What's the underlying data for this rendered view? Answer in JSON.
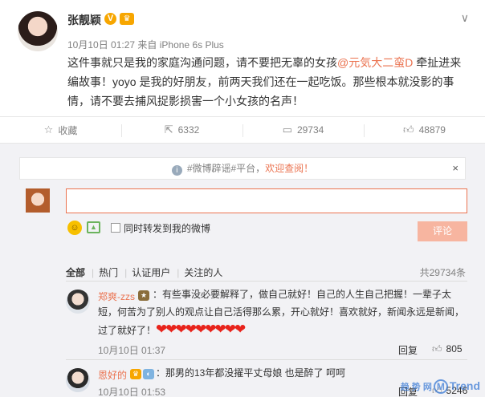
{
  "post": {
    "author": "张靓颖",
    "verified_mark": "V",
    "vip_mark": "♛",
    "time": "10月10日 01:27",
    "source": "来自 iPhone 6s Plus",
    "text_before": "这件事就只是我的家庭沟通问题，请不要把无辜的女孩",
    "mention": "@元気大二蛮D",
    "text_after": " 牵扯进来编故事！yoyo 是我的好朋友，前两天我们还在一起吃饭。那些根本就没影的事情，请不要去捕风捉影损害一个小女孩的名声！",
    "menu_icon": "chevron-down-icon"
  },
  "actions": {
    "favorite": {
      "icon": "star-icon",
      "label": "收藏"
    },
    "repost": {
      "icon": "repost-icon",
      "label": "6332"
    },
    "comment": {
      "icon": "comment-icon",
      "label": "29734"
    },
    "like": {
      "icon": "thumb-up-icon",
      "label": "48879"
    }
  },
  "notice": {
    "text": "#微博辟谣#平台，",
    "link": "欢迎查阅！",
    "close": "×"
  },
  "compose": {
    "value": "",
    "repost_label": "同时转发到我的微博",
    "submit": "评论"
  },
  "filters": {
    "items": [
      "全部",
      "热门",
      "认证用户",
      "关注的人"
    ],
    "total": "共29734条"
  },
  "comments": [
    {
      "name": "郑爽-zzs",
      "text": "：有些事没必要解释了，做自己就好！自己的人生自己把握！一辈子太短，何苦为了别人的观点让自己活得那么累，开心就好！喜欢就好，新闻永远是新闻，过了就好了！",
      "hearts": "❤❤❤❤❤❤❤❤❤",
      "time": "10月10日 01:37",
      "reply": "回复",
      "likes": "805"
    },
    {
      "name": "恩好的",
      "text": "：那男的13年都没擢平丈母娘 也是醉了 呵呵",
      "time": "10月10日 01:53",
      "reply": "回复",
      "likes": "5246"
    }
  ],
  "watermark": {
    "cn": "趋 势 网",
    "m": "M",
    "en": "Trend"
  },
  "colors": {
    "accent": "#eb7350",
    "submit_disabled": "#f7b5a0",
    "comments_bg": "#f2f2f5",
    "verified": "#f7a600"
  }
}
